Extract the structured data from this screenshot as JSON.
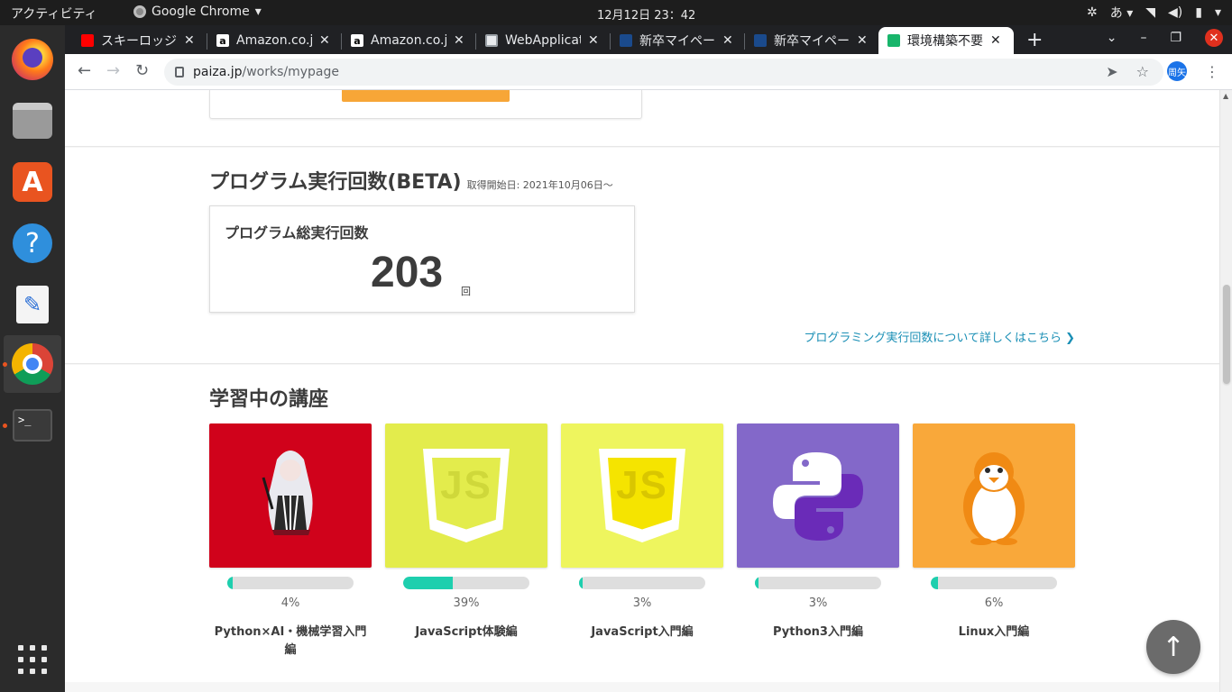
{
  "os": {
    "activities": "アクティビティ",
    "app_menu": "Google Chrome",
    "clock": "12月12日  23：42",
    "ime": "あ"
  },
  "browser": {
    "tabs": [
      {
        "title": "スキーロッジ",
        "favicon": "youtube-icon"
      },
      {
        "title": "Amazon.co.jp",
        "favicon": "amazon-icon"
      },
      {
        "title": "Amazon.co.jp",
        "favicon": "amazon-icon"
      },
      {
        "title": "WebApplication",
        "favicon": "image-icon"
      },
      {
        "title": "新卒マイページ",
        "favicon": "globe-icon"
      },
      {
        "title": "新卒マイページ",
        "favicon": "globe-icon"
      },
      {
        "title": "環境構築不要",
        "favicon": "paiza-icon"
      }
    ],
    "url_host": "paiza.jp",
    "url_path": "/works/mypage",
    "avatar_text": "周矢"
  },
  "exec_section": {
    "title": "プログラム実行回数(BETA)",
    "subtitle": "取得開始日: 2021年10月06日〜",
    "card_label": "プログラム総実行回数",
    "count": "203",
    "unit": "回",
    "more_link": "プログラミング実行回数について詳しくはこちら"
  },
  "courses_section": {
    "title": "学習中の講座",
    "courses": [
      {
        "name": "Python×AI・機械学習入門編",
        "percent_label": "4%",
        "progress": 0.04,
        "thumb_color": "#d0021b",
        "icon": "anime-character-icon"
      },
      {
        "name": "JavaScript体験編",
        "percent_label": "39%",
        "progress": 0.39,
        "thumb_color": "#e3ec4c",
        "icon": "javascript-icon"
      },
      {
        "name": "JavaScript入門編",
        "percent_label": "3%",
        "progress": 0.03,
        "thumb_color": "#eef55e",
        "icon": "javascript-icon"
      },
      {
        "name": "Python3入門編",
        "percent_label": "3%",
        "progress": 0.03,
        "thumb_color": "#8368c9",
        "icon": "python-icon"
      },
      {
        "name": "Linux入門編",
        "percent_label": "6%",
        "progress": 0.06,
        "thumb_color": "#f9a83a",
        "icon": "penguin-icon"
      }
    ]
  },
  "colors": {
    "progress_fill": "#1ecfae",
    "link": "#1a8fb5",
    "accent_button": "#f7a637"
  }
}
